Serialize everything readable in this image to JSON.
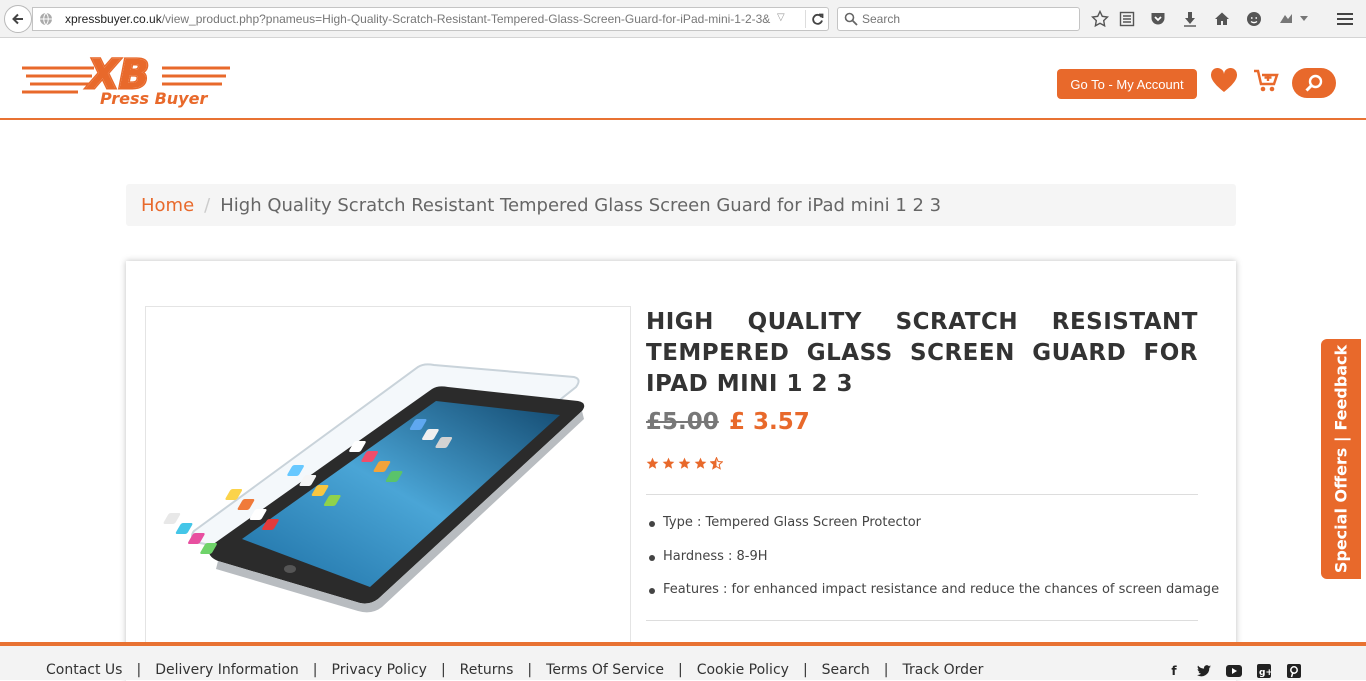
{
  "browser": {
    "url_domain": "xpressbuyer.co.uk",
    "url_path": "/view_product.php?pnameus=High-Quality-Scratch-Resistant-Tempered-Glass-Screen-Guard-for-iPad-mini-1-2-3&",
    "search_placeholder": "Search"
  },
  "header": {
    "logo_text_top": "XB",
    "logo_text_bottom": "Press Buyer",
    "account_label": "Go To - My Account",
    "accent": "#e8692b"
  },
  "breadcrumb": {
    "home": "Home",
    "separator": "/",
    "current": "High Quality Scratch Resistant Tempered Glass Screen Guard for iPad mini 1 2 3"
  },
  "product": {
    "title": "HIGH QUALITY SCRATCH RESISTANT TEMPERED GLASS SCREEN GUARD FOR IPAD MINI 1 2 3",
    "old_price": "£5.00",
    "new_price": "£ 3.57",
    "rating": 4.5,
    "features": [
      "Type : Tempered Glass Screen Protector",
      "Hardness : 8-9H",
      "Features : for enhanced impact resistance and reduce the chances of screen damage"
    ]
  },
  "feedback_tab": "Special Offers | Feedback",
  "footer": {
    "links": [
      "Contact Us",
      "Delivery Information",
      "Privacy Policy",
      "Returns",
      "Terms Of Service",
      "Cookie Policy",
      "Search",
      "Track Order"
    ],
    "separator": "|",
    "social_icons": [
      "facebook-icon",
      "twitter-icon",
      "youtube-icon",
      "google-plus-icon",
      "pinterest-icon"
    ]
  }
}
